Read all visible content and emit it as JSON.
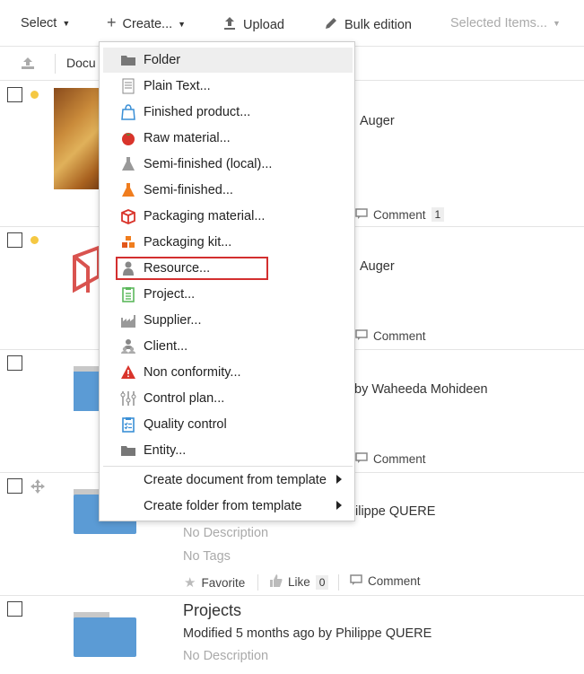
{
  "toolbar": {
    "select_label": "Select",
    "create_label": "Create...",
    "upload_label": "Upload",
    "bulk_label": "Bulk edition",
    "selected_items_label": "Selected Items..."
  },
  "subheader": {
    "column_label": "Docu"
  },
  "rows": [
    {
      "author_fragment": "Auger",
      "comment_label": "Comment",
      "comment_count": "1"
    },
    {
      "author_fragment": "Auger",
      "comment_label": "Comment"
    },
    {
      "author_fragment": "by Waheeda Mohideen",
      "comment_label": "Comment"
    },
    {
      "author_fragment": "ilippe QUERE",
      "description": "No Description",
      "tags": "No Tags",
      "favorite_label": "Favorite",
      "like_label": "Like",
      "like_count": "0",
      "comment_label": "Comment"
    },
    {
      "title": "Projects",
      "modified": "Modified 5 months ago by Philippe QUERE",
      "description": "No Description"
    }
  ],
  "create_menu": {
    "items": [
      {
        "label": "Folder",
        "icon": "folder-icon"
      },
      {
        "label": "Plain Text...",
        "icon": "text-document-icon"
      },
      {
        "label": "Finished product...",
        "icon": "shopping-bag-icon"
      },
      {
        "label": "Raw material...",
        "icon": "tomato-icon"
      },
      {
        "label": "Semi-finished (local)...",
        "icon": "flask-grey-icon"
      },
      {
        "label": "Semi-finished...",
        "icon": "flask-orange-icon"
      },
      {
        "label": "Packaging material...",
        "icon": "box-icon"
      },
      {
        "label": "Packaging kit...",
        "icon": "stacked-boxes-icon"
      },
      {
        "label": "Resource...",
        "icon": "person-icon"
      },
      {
        "label": "Project...",
        "icon": "clipboard-icon"
      },
      {
        "label": "Supplier...",
        "icon": "factory-icon"
      },
      {
        "label": "Client...",
        "icon": "people-icon"
      },
      {
        "label": "Non conformity...",
        "icon": "warning-icon"
      },
      {
        "label": "Control plan...",
        "icon": "sliders-icon"
      },
      {
        "label": "Quality control",
        "icon": "checklist-icon"
      },
      {
        "label": "Entity...",
        "icon": "folder-icon"
      }
    ],
    "template_items": [
      {
        "label": "Create document from template"
      },
      {
        "label": "Create folder from template"
      }
    ]
  },
  "colors": {
    "folder_blue": "#5b9bd5",
    "highlight_box": "#d32f2f",
    "status_dot": "#f5c842"
  }
}
